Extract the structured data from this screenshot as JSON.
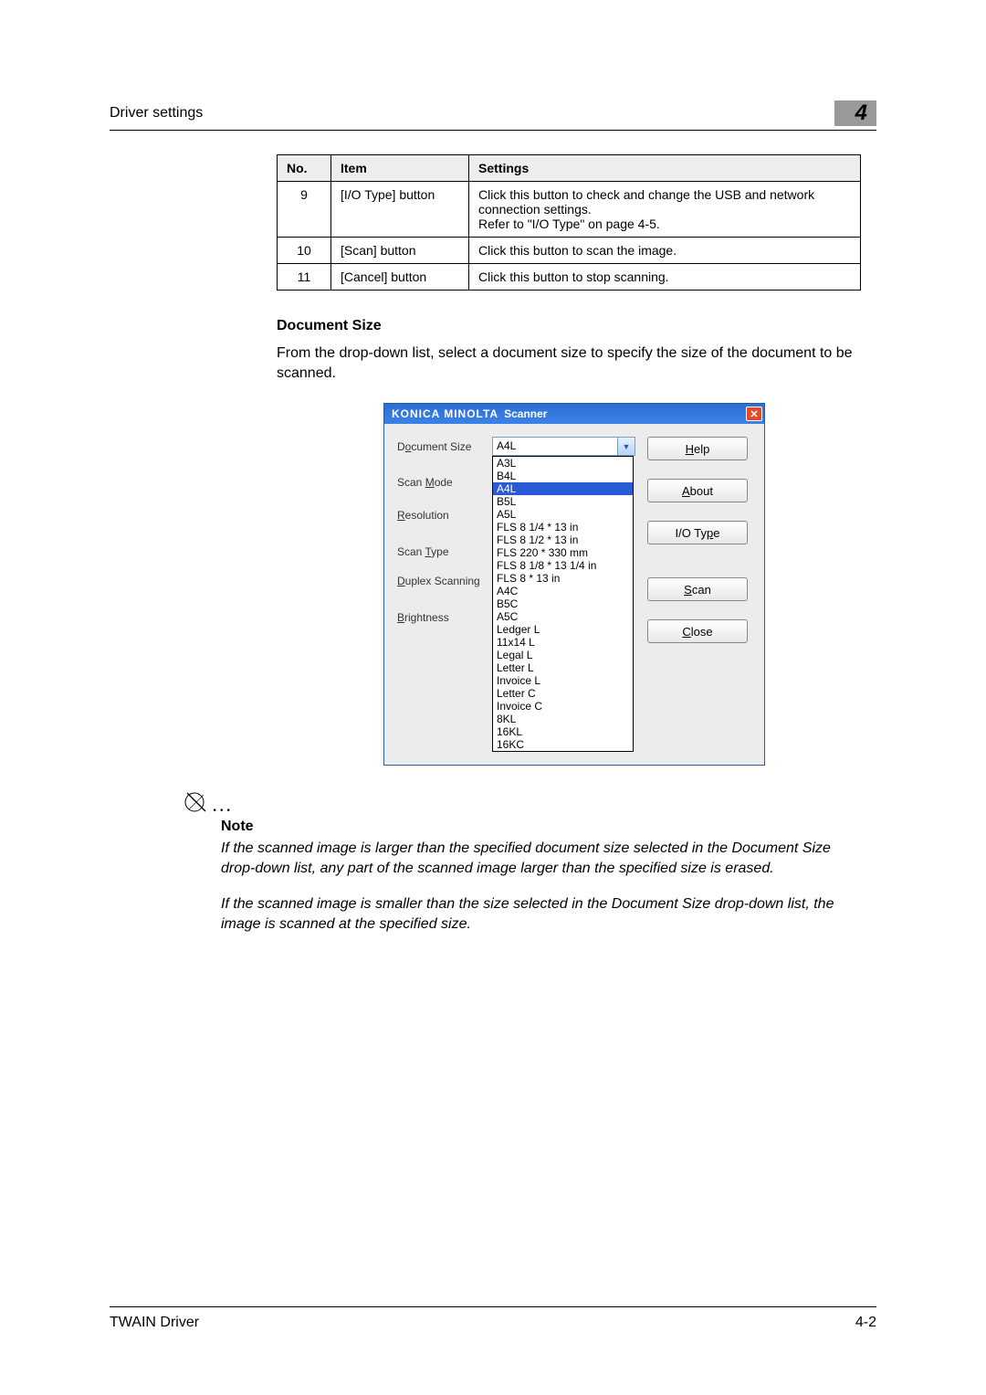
{
  "header": {
    "left": "Driver settings",
    "chapter": "4"
  },
  "table": {
    "headers": [
      "No.",
      "Item",
      "Settings"
    ],
    "rows": [
      {
        "no": "9",
        "item": "[I/O Type] button",
        "settings": "Click this button to check and change the USB and network connection settings.\nRefer to \"I/O Type\" on page 4-5."
      },
      {
        "no": "10",
        "item": "[Scan] button",
        "settings": "Click this button to scan the image."
      },
      {
        "no": "11",
        "item": "[Cancel] button",
        "settings": "Click this button to stop scanning."
      }
    ]
  },
  "section": {
    "title": "Document Size",
    "para": "From the drop-down list, select a document size to specify the size of the document to be scanned."
  },
  "dialog": {
    "title_brand": "KONICA MINOLTA",
    "title_tail": "Scanner",
    "labels": {
      "document_size": "Document Size",
      "scan_mode": "Scan Mode",
      "resolution": "Resolution",
      "scan_type": "Scan Type",
      "duplex": "Duplex Scanning",
      "brightness": "Brightness"
    },
    "selected": "A4L",
    "options": [
      "A3L",
      "B4L",
      "A4L",
      "B5L",
      "A5L",
      "FLS 8 1/4 * 13 in",
      "FLS 8 1/2 * 13 in",
      "FLS 220 * 330 mm",
      "FLS 8 1/8 * 13 1/4 in",
      "FLS 8 * 13 in",
      "A4C",
      "B5C",
      "A5C",
      "Ledger L",
      "11x14 L",
      "Legal L",
      "Letter L",
      "Invoice L",
      "Letter C",
      "Invoice C",
      "8KL",
      "16KL",
      "16KC"
    ],
    "selected_index": 2,
    "buttons": {
      "help": {
        "pre": "",
        "u": "H",
        "post": "elp"
      },
      "about": {
        "pre": "",
        "u": "A",
        "post": "bout"
      },
      "iotype": {
        "pre": "I/O Ty",
        "u": "p",
        "post": "e"
      },
      "scan": {
        "pre": "",
        "u": "S",
        "post": "can"
      },
      "close": {
        "pre": "",
        "u": "C",
        "post": "lose"
      }
    }
  },
  "note": {
    "label": "Note",
    "para1": "If the scanned image is larger than the specified document size selected in the Document Size drop-down list, any part of the scanned image larger than the specified size is erased.",
    "para2": "If the scanned image is smaller than the size selected in the Document Size drop-down list, the image is scanned at the specified size."
  },
  "footer": {
    "left": "TWAIN Driver",
    "right": "4-2"
  }
}
